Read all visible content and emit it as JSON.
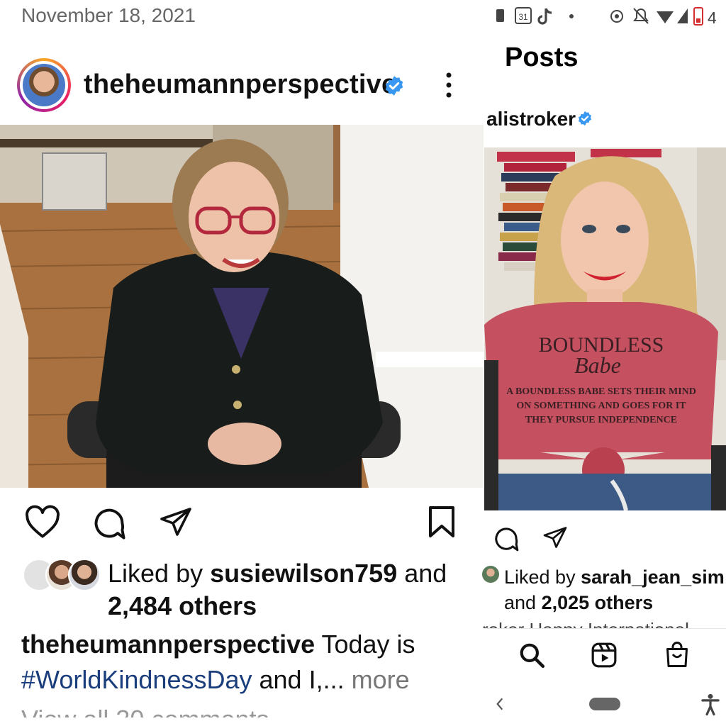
{
  "left_post": {
    "date": "November 18, 2021",
    "username": "theheumannperspective",
    "liked_by_prefix": "Liked by ",
    "liked_by_user": "susiewilson759",
    "liked_by_and": " and",
    "liked_by_count": "2,484 others",
    "caption_user": "theheumannperspective",
    "caption_text": " Today is",
    "caption_hashtag": "#WorldKindnessDay",
    "caption_rest": " and I,...",
    "caption_more": " more",
    "cutoff_text": "View all 30 comments"
  },
  "right_post": {
    "battery_level": "4",
    "calendar_day": "31",
    "header_title": "Posts",
    "username": "alistroker",
    "liked_by_prefix": "Liked by ",
    "liked_by_user": "sarah_jean_sim",
    "liked_by_and": "and ",
    "liked_by_count": "2,025 others",
    "cutoff_text": "roker Happy International"
  },
  "shirt_text": {
    "line1": "BOUNDLESS",
    "line2": "Babe",
    "line3": "A BOUNDLESS BABE SETS THEIR MIND",
    "line4": "ON SOMETHING AND GOES FOR IT",
    "line5": "THEY PURSUE INDEPENDENCE"
  },
  "colors": {
    "verified": "#3897f0",
    "hashtag": "#1a3d7c",
    "shirt": "#c5505f"
  }
}
